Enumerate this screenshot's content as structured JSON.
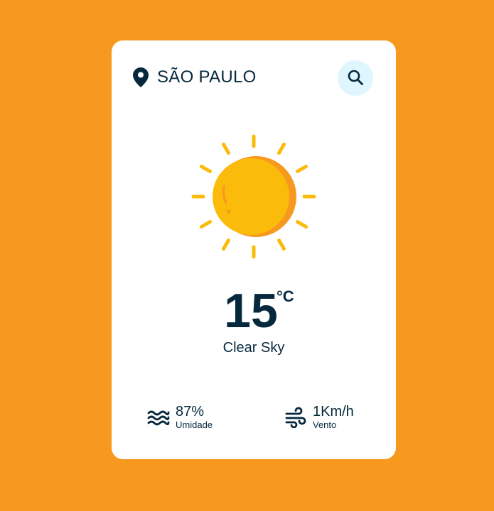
{
  "location": {
    "icon": "map-pin-icon",
    "city": "SÃO PAULO"
  },
  "search": {
    "icon": "search-icon"
  },
  "weather": {
    "icon": "sun-icon",
    "temperature": "15",
    "unit": "°C",
    "description": "Clear Sky"
  },
  "details": {
    "humidity": {
      "icon": "waves-icon",
      "value": "87%",
      "label": "Umidade"
    },
    "wind": {
      "icon": "wind-icon",
      "value": "1Km/h",
      "label": "Vento"
    }
  },
  "colors": {
    "background": "#F7991F",
    "card": "#FFFFFF",
    "text": "#06283D",
    "search_button_bg": "#DFF6FF",
    "sun": "#FABB0B",
    "sun_shadow": "#F7991F"
  }
}
